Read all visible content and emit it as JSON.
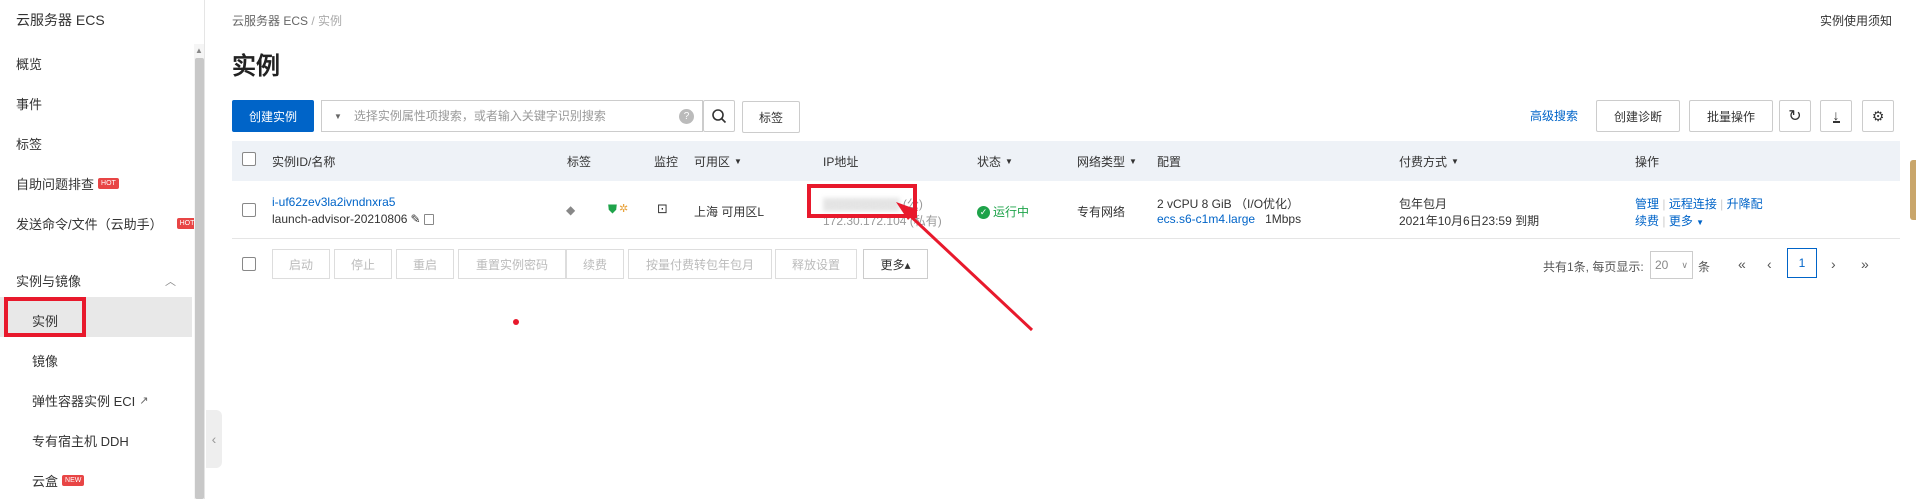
{
  "sidebar": {
    "title": "云服务器 ECS",
    "items": [
      {
        "label": "概览"
      },
      {
        "label": "事件"
      },
      {
        "label": "标签"
      },
      {
        "label": "自助问题排查",
        "badge": "HOT"
      },
      {
        "label": "发送命令/文件（云助手）",
        "badge": "HOT"
      }
    ],
    "group_label": "实例与镜像",
    "sub_items": [
      {
        "label": "实例"
      },
      {
        "label": "镜像"
      },
      {
        "label": "弹性容器实例 ECI"
      },
      {
        "label": "专有宿主机 DDH"
      },
      {
        "label": "云盒",
        "badge": "NEW"
      }
    ]
  },
  "header": {
    "breadcrumb_root": "云服务器 ECS",
    "breadcrumb_sep": "/",
    "breadcrumb_current": "实例",
    "notice": "实例使用须知",
    "title": "实例"
  },
  "toolbar": {
    "create_label": "创建实例",
    "search_placeholder": "选择实例属性项搜索，或者输入关键字识别搜索",
    "tag_label": "标签",
    "advanced_search": "高级搜索",
    "diagnose_label": "创建诊断",
    "batch_label": "批量操作"
  },
  "table": {
    "headers": {
      "id_name": "实例ID/名称",
      "tag": "标签",
      "monitor": "监控",
      "zone": "可用区",
      "ip": "IP地址",
      "status": "状态",
      "network": "网络类型",
      "config": "配置",
      "billing": "付费方式",
      "actions": "操作"
    },
    "row": {
      "instance_id": "i-uf62zev3la2ivndnxra5",
      "instance_name": "launch-advisor-20210806",
      "zone": "上海 可用区L",
      "ip_public": "(公)",
      "ip_private": "172.30.172.104",
      "ip_private_suffix": "(私有)",
      "status": "运行中",
      "network": "专有网络",
      "config_spec": "2 vCPU 8 GiB （I/O优化）",
      "config_type": "ecs.s6-c1m4.large",
      "config_bandwidth": "1Mbps",
      "billing_type": "包年包月",
      "billing_expire": "2021年10月6日23:59 到期",
      "action_manage": "管理",
      "action_remote": "远程连接",
      "action_upgrade": "升降配",
      "action_renew": "续费",
      "action_more": "更多"
    }
  },
  "footer": {
    "buttons": [
      "启动",
      "停止",
      "重启",
      "重置实例密码",
      "续费",
      "按量付费转包年包月",
      "释放设置"
    ],
    "more_label": "更多▴",
    "summary": "共有1条, 每页显示:",
    "page_size": "20",
    "page_size_unit": "条",
    "current_page": "1"
  },
  "colors": {
    "primary": "#0064c8",
    "highlight": "#e8192c",
    "status_running": "#1ea34a",
    "hot_badge": "#e84545"
  }
}
